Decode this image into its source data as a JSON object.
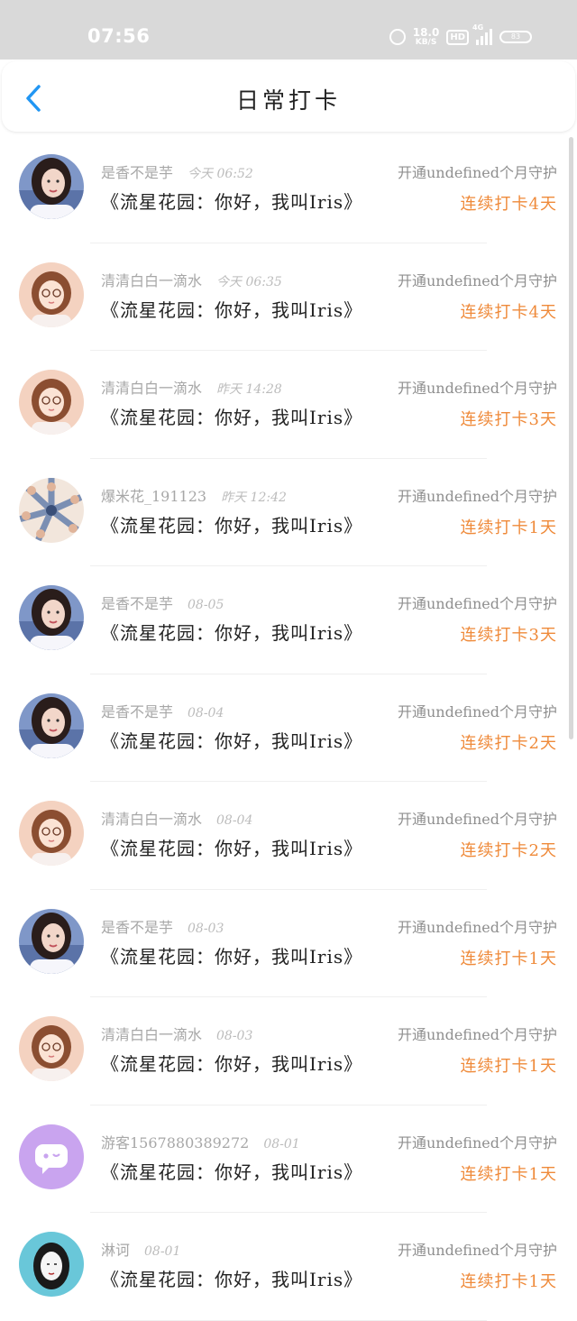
{
  "status_bar": {
    "time": "07:56",
    "net_speed_value": "18.0",
    "net_speed_unit": "KB/S",
    "hd_label": "HD",
    "network_label": "4G",
    "battery_level": "83"
  },
  "header": {
    "title": "日常打卡",
    "back_icon": "chevron-left-icon"
  },
  "colors": {
    "accent_back": "#2196f3",
    "streak": "#ef8a3a"
  },
  "records": [
    {
      "user": "是香不是芋",
      "time": "今天 06:52",
      "guard": "开通undefined个月守护",
      "content": "《流星花园：你好，我叫Iris》",
      "streak": "连续打卡4天",
      "avatar": "girl-photo"
    },
    {
      "user": "清清白白一滴水",
      "time": "今天 06:35",
      "guard": "开通undefined个月守护",
      "content": "《流星花园：你好，我叫Iris》",
      "streak": "连续打卡4天",
      "avatar": "cartoon-girl"
    },
    {
      "user": "清清白白一滴水",
      "time": "昨天 14:28",
      "guard": "开通undefined个月守护",
      "content": "《流星花园：你好，我叫Iris》",
      "streak": "连续打卡3天",
      "avatar": "cartoon-girl"
    },
    {
      "user": "爆米花_191123",
      "time": "昨天 12:42",
      "guard": "开通undefined个月守护",
      "content": "《流星花园：你好，我叫Iris》",
      "streak": "连续打卡1天",
      "avatar": "group-collage"
    },
    {
      "user": "是香不是芋",
      "time": "08-05",
      "guard": "开通undefined个月守护",
      "content": "《流星花园：你好，我叫Iris》",
      "streak": "连续打卡3天",
      "avatar": "girl-photo"
    },
    {
      "user": "是香不是芋",
      "time": "08-04",
      "guard": "开通undefined个月守护",
      "content": "《流星花园：你好，我叫Iris》",
      "streak": "连续打卡2天",
      "avatar": "girl-photo"
    },
    {
      "user": "清清白白一滴水",
      "time": "08-04",
      "guard": "开通undefined个月守护",
      "content": "《流星花园：你好，我叫Iris》",
      "streak": "连续打卡2天",
      "avatar": "cartoon-girl"
    },
    {
      "user": "是香不是芋",
      "time": "08-03",
      "guard": "开通undefined个月守护",
      "content": "《流星花园：你好，我叫Iris》",
      "streak": "连续打卡1天",
      "avatar": "girl-photo"
    },
    {
      "user": "清清白白一滴水",
      "time": "08-03",
      "guard": "开通undefined个月守护",
      "content": "《流星花园：你好，我叫Iris》",
      "streak": "连续打卡1天",
      "avatar": "cartoon-girl"
    },
    {
      "user": "游客1567880389272",
      "time": "08-01",
      "guard": "开通undefined个月守护",
      "content": "《流星花园：你好，我叫Iris》",
      "streak": "连续打卡1天",
      "avatar": "default-chat"
    },
    {
      "user": "淋诃",
      "time": "08-01",
      "guard": "开通undefined个月守护",
      "content": "《流星花园：你好，我叫Iris》",
      "streak": "连续打卡1天",
      "avatar": "sketch-girl"
    }
  ]
}
